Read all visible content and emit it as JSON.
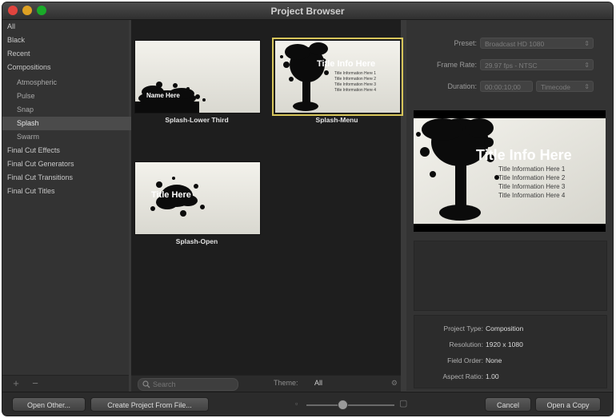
{
  "window": {
    "title": "Project Browser"
  },
  "colors": {
    "selection_outline": "#d7c55a",
    "sidebar_selected": "#4b4b4b"
  },
  "sidebar": {
    "items": [
      {
        "label": "All"
      },
      {
        "label": "Black"
      },
      {
        "label": "Recent"
      },
      {
        "label": "Compositions"
      },
      {
        "label": "Atmospheric"
      },
      {
        "label": "Pulse"
      },
      {
        "label": "Snap"
      },
      {
        "label": "Splash"
      },
      {
        "label": "Swarm"
      },
      {
        "label": "Final Cut Effects"
      },
      {
        "label": "Final Cut Generators"
      },
      {
        "label": "Final Cut Transitions"
      },
      {
        "label": "Final Cut Titles"
      }
    ],
    "add_icon": "+",
    "remove_icon": "−"
  },
  "browser": {
    "items": [
      {
        "caption": "Splash-Lower Third",
        "overlay": "Name Here"
      },
      {
        "caption": "Splash-Menu",
        "overlay": "Title Info Here"
      },
      {
        "caption": "Splash-Open",
        "overlay": "Title Here"
      }
    ],
    "menu_lines": [
      "Title Information Here 1",
      "Title Information Here 2",
      "Title Information Here 3",
      "Title Information Here 4"
    ],
    "search_placeholder": "Search",
    "theme_label": "Theme:",
    "theme_value": "All"
  },
  "settings": {
    "preset_label": "Preset:",
    "preset_value": "Broadcast HD 1080",
    "frame_rate_label": "Frame Rate:",
    "frame_rate_value": "29.97 fps - NTSC",
    "duration_label": "Duration:",
    "duration_value": "00:00:10;00",
    "duration_unit": "Timecode"
  },
  "preview": {
    "title": "Title Info Here",
    "lines": [
      "Title Information Here 1",
      "Title Information Here 2",
      "Title Information Here 3",
      "Title Information Here 4"
    ]
  },
  "info": [
    {
      "key": "Project Type:",
      "value": "Composition"
    },
    {
      "key": "Resolution:",
      "value": "1920 x 1080"
    },
    {
      "key": "Field Order:",
      "value": "None"
    },
    {
      "key": "Aspect Ratio:",
      "value": "1.00"
    }
  ],
  "footer": {
    "open_other": "Open Other...",
    "create_from_file": "Create Project From File...",
    "cancel": "Cancel",
    "open_copy": "Open a Copy"
  }
}
